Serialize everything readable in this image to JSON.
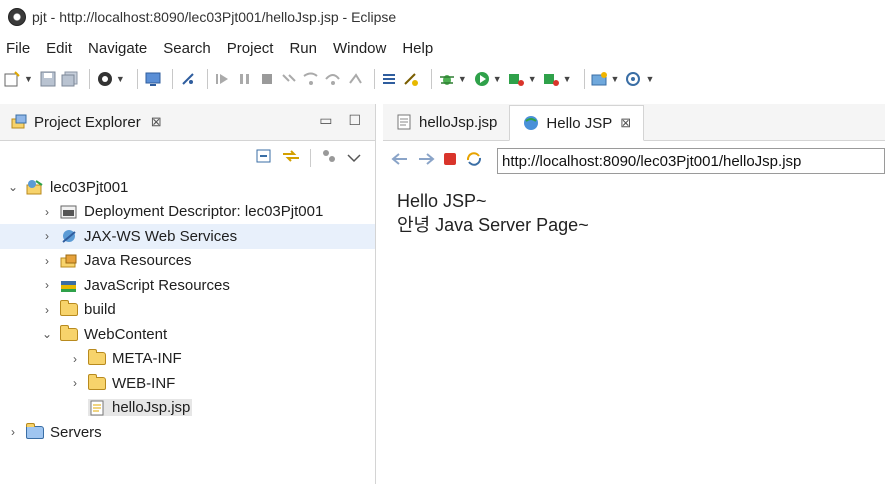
{
  "window": {
    "title": "pjt - http://localhost:8090/lec03Pjt001/helloJsp.jsp - Eclipse"
  },
  "menu": [
    "File",
    "Edit",
    "Navigate",
    "Search",
    "Project",
    "Run",
    "Window",
    "Help"
  ],
  "project_explorer": {
    "tab_label": "Project Explorer",
    "close_glyph": "⊠",
    "tree": [
      {
        "label": "lec03Pjt001"
      },
      {
        "label": "Deployment Descriptor: lec03Pjt001"
      },
      {
        "label": "JAX-WS Web Services"
      },
      {
        "label": "Java Resources"
      },
      {
        "label": "JavaScript Resources"
      },
      {
        "label": "build"
      },
      {
        "label": "WebContent"
      },
      {
        "label": "META-INF"
      },
      {
        "label": "WEB-INF"
      },
      {
        "label": "helloJsp.jsp"
      },
      {
        "label": "Servers"
      }
    ]
  },
  "editor": {
    "tabs": [
      {
        "label": "helloJsp.jsp"
      },
      {
        "label": "Hello JSP"
      }
    ],
    "close_glyph": "⊠",
    "url": "http://localhost:8090/lec03Pjt001/helloJsp.jsp",
    "content": {
      "line1": "Hello JSP~",
      "line2": "안녕 Java Server Page~"
    }
  },
  "colors": {
    "selection_highlight": "#e8f0fb",
    "active_item": "#e6e6e6",
    "stop_red": "#d9342b"
  }
}
